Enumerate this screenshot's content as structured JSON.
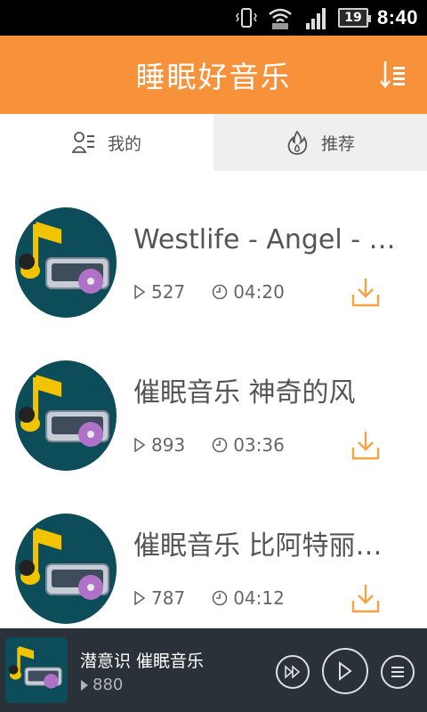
{
  "status_bar": {
    "time": "8:40",
    "battery": "19",
    "icons": [
      "vibrate-icon",
      "wifi-icon",
      "signal-icon",
      "battery-icon"
    ]
  },
  "header": {
    "title": "睡眠好音乐",
    "sort_icon": "sort-icon"
  },
  "tabs": [
    {
      "label": "我的",
      "icon": "person-list-icon",
      "active": true
    },
    {
      "label": "推荐",
      "icon": "flame-icon",
      "active": false
    }
  ],
  "songs": [
    {
      "title": "Westlife - Angel - 催...",
      "plays": "527",
      "duration": "04:20"
    },
    {
      "title": "催眠音乐 神奇的风",
      "plays": "893",
      "duration": "03:36"
    },
    {
      "title": "催眠音乐 比阿特丽克斯",
      "plays": "787",
      "duration": "04:12"
    }
  ],
  "player": {
    "title": "潜意识 催眠音乐",
    "plays": "880"
  },
  "colors": {
    "accent": "#f7923a",
    "player_bg": "#2b3138",
    "album_bg": "#0d4d59"
  }
}
